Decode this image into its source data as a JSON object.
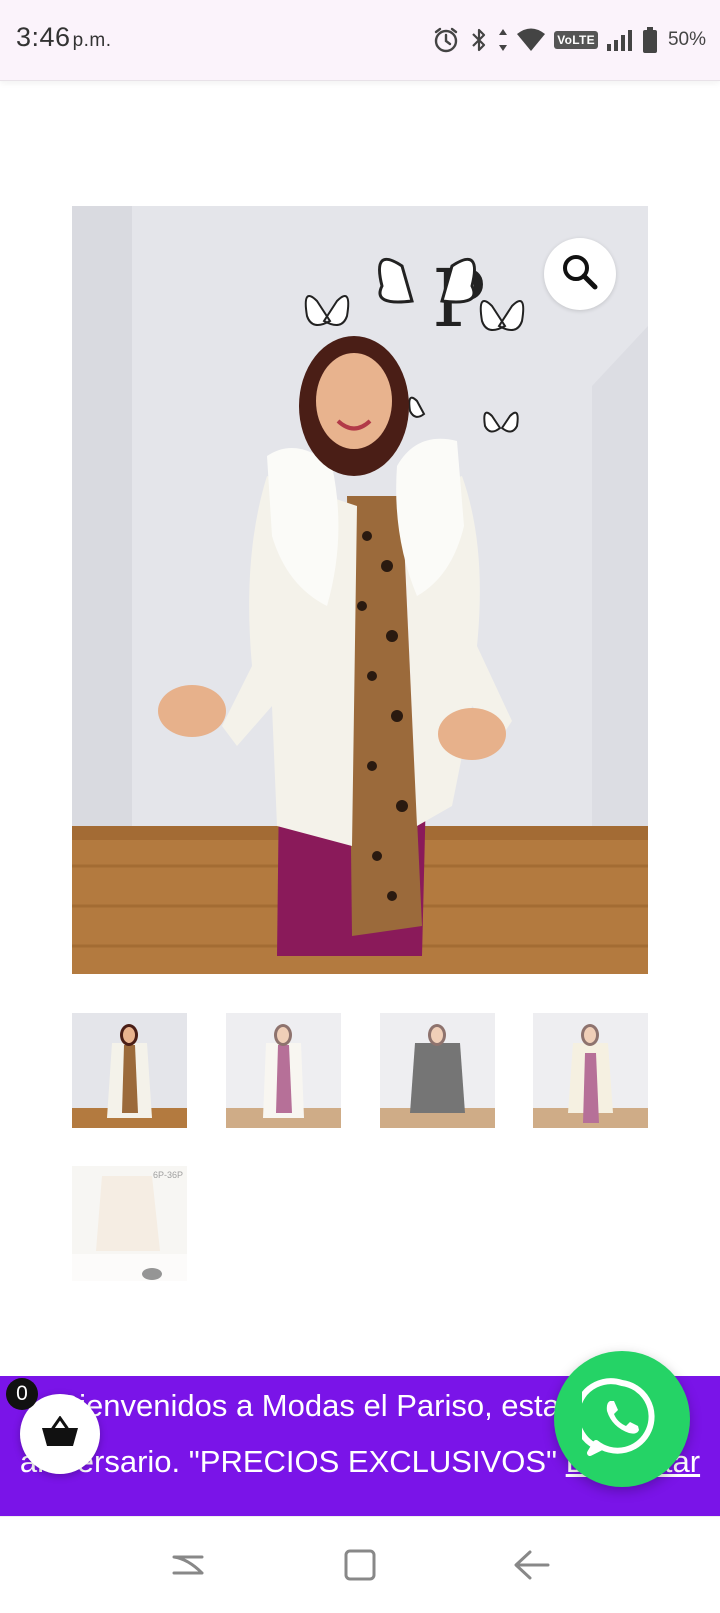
{
  "status_bar": {
    "time": "3:46",
    "ampm": "p.m.",
    "network_label": "VoLTE",
    "battery": "50%"
  },
  "product": {
    "gallery": {
      "thumbnail_count": 5,
      "thumb_5_label": "6P-36P"
    }
  },
  "promo": {
    "line1": "Bienvenidos a Modas el Pariso, estamos de",
    "line2": "aniversario. \"PRECIOS EXCLUSIVOS\"",
    "dismiss": "Descartar"
  },
  "cart": {
    "count": "0"
  },
  "colors": {
    "banner_bg": "#7a14e8",
    "whatsapp_green": "#25d366",
    "status_bg": "#fbf3fb"
  }
}
